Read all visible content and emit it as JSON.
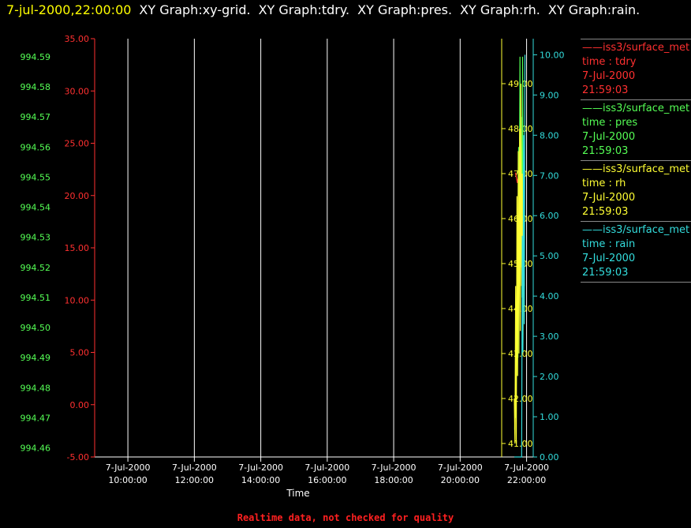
{
  "header": {
    "timestamp": "7-jul-2000,22:00:00",
    "graphs": [
      "XY Graph:xy-grid.",
      "XY Graph:tdry.",
      "XY Graph:pres.",
      "XY Graph:rh.",
      "XY Graph:rain."
    ]
  },
  "colors": {
    "tdry": "#ff3030",
    "pres": "#55ff55",
    "rh": "#ffff33",
    "rain": "#33dddd",
    "grid": "#ffffff"
  },
  "legend": [
    {
      "source": "iss3/surface_met",
      "field": "time : tdry",
      "date": "7-Jul-2000",
      "time": "21:59:03",
      "color": "#ff3030"
    },
    {
      "source": "iss3/surface_met",
      "field": "time : pres",
      "date": "7-Jul-2000",
      "time": "21:59:03",
      "color": "#55ff55"
    },
    {
      "source": "iss3/surface_met",
      "field": "time : rh",
      "date": "7-Jul-2000",
      "time": "21:59:03",
      "color": "#ffff33"
    },
    {
      "source": "iss3/surface_met",
      "field": "time : rain",
      "date": "7-Jul-2000",
      "time": "21:59:03",
      "color": "#33dddd"
    }
  ],
  "footer": "Realtime data, not checked for quality",
  "chart_data": {
    "type": "line",
    "xlabel": "Time",
    "x_ticks": [
      {
        "date": "7-Jul-2000",
        "time": "10:00:00",
        "hour": 10
      },
      {
        "date": "7-Jul-2000",
        "time": "12:00:00",
        "hour": 12
      },
      {
        "date": "7-Jul-2000",
        "time": "14:00:00",
        "hour": 14
      },
      {
        "date": "7-Jul-2000",
        "time": "16:00:00",
        "hour": 16
      },
      {
        "date": "7-Jul-2000",
        "time": "18:00:00",
        "hour": 18
      },
      {
        "date": "7-Jul-2000",
        "time": "20:00:00",
        "hour": 20
      },
      {
        "date": "7-Jul-2000",
        "time": "22:00:00",
        "hour": 22
      }
    ],
    "xlim": [
      9.0,
      22.2
    ],
    "grid": "vertical",
    "axes": {
      "tdry": {
        "range": [
          -5.0,
          35.0
        ],
        "ticks": [
          "-5.00",
          "0.00",
          "5.00",
          "10.00",
          "15.00",
          "20.00",
          "25.00",
          "30.00",
          "35.00"
        ]
      },
      "pres": {
        "range": [
          994.457,
          994.596
        ],
        "ticks": [
          "994.46",
          "994.47",
          "994.48",
          "994.49",
          "994.50",
          "994.51",
          "994.52",
          "994.53",
          "994.54",
          "994.55",
          "994.56",
          "994.57",
          "994.58",
          "994.59"
        ]
      },
      "rh": {
        "range": [
          40.7,
          50.0
        ],
        "ticks": [
          "41.00",
          "42.00",
          "43.00",
          "44.00",
          "45.00",
          "46.00",
          "47.00",
          "48.00",
          "49.00"
        ]
      },
      "rain": {
        "range": [
          0.0,
          10.4
        ],
        "ticks": [
          "0.00",
          "1.00",
          "2.00",
          "3.00",
          "4.00",
          "5.00",
          "6.00",
          "7.00",
          "8.00",
          "9.00",
          "10.00"
        ]
      }
    },
    "series": [
      {
        "name": "time : tdry",
        "axis": "tdry",
        "x": [
          21.66,
          21.69,
          21.72,
          21.74,
          21.77
        ],
        "y": [
          22.2,
          21.8,
          21.2,
          21.6,
          20.8
        ]
      },
      {
        "name": "time : pres",
        "axis": "pres",
        "x": [
          21.64,
          21.66,
          21.68,
          21.7,
          21.72,
          21.74,
          21.76,
          21.78,
          21.8,
          21.82,
          21.84,
          21.86,
          21.88,
          21.9,
          21.92
        ],
        "y": [
          994.466,
          994.475,
          994.47,
          994.49,
          994.51,
          994.49,
          994.56,
          994.54,
          994.59,
          994.52,
          994.57,
          994.51,
          994.59,
          994.53,
          994.55
        ]
      },
      {
        "name": "time : rh",
        "axis": "rh",
        "x": [
          21.63,
          21.65,
          21.67,
          21.69,
          21.71,
          21.73,
          21.75,
          21.77,
          21.79,
          21.81,
          21.83,
          21.85,
          21.87,
          21.89,
          21.91,
          21.93
        ],
        "y": [
          42.0,
          41.0,
          44.5,
          41.0,
          46.5,
          42.5,
          47.5,
          43.0,
          48.0,
          43.5,
          49.0,
          44.5,
          47.0,
          43.0,
          46.0,
          44.5
        ]
      },
      {
        "name": "time : rain",
        "axis": "rain",
        "x": [
          21.63,
          21.85,
          21.87,
          21.89,
          21.91,
          21.93,
          21.95
        ],
        "y": [
          0.0,
          0.0,
          5.5,
          2.6,
          8.0,
          3.3,
          10.0
        ]
      }
    ]
  }
}
